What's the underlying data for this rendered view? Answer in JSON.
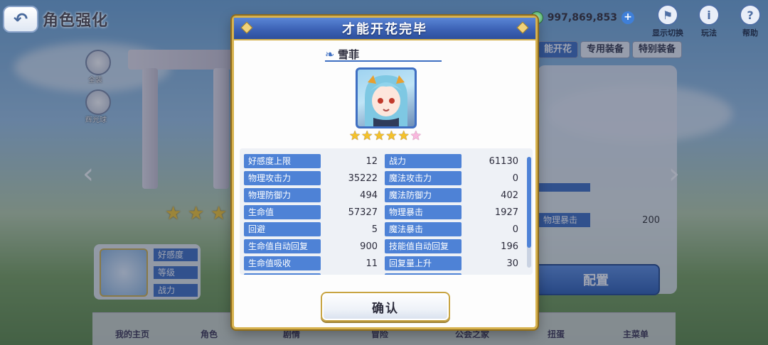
{
  "header": {
    "back_glyph": "↶",
    "title": "角色强化"
  },
  "currency": {
    "gems": "997,869,853",
    "plus": "+"
  },
  "hud_buttons": [
    {
      "icon": "display-toggle-icon",
      "label": "显示切换"
    },
    {
      "icon": "info-icon",
      "label": "玩法"
    },
    {
      "icon": "help-icon",
      "label": "帮助"
    }
  ],
  "side": {
    "btn1": "全装",
    "btn2": "辉光球"
  },
  "tabs": [
    "能开花",
    "专用装备",
    "特别装备"
  ],
  "right_panel": {
    "stat_label": "物理暴击",
    "stat_value": "200",
    "deploy": "配置"
  },
  "left_card": {
    "rows": [
      "好感度",
      "等级",
      "战力"
    ]
  },
  "bottom_nav": [
    "我的主页",
    "角色",
    "剧情",
    "冒险",
    "公会之家",
    "扭蛋",
    "主菜单"
  ],
  "dialog": {
    "title": "才能开花完毕",
    "character_name": "雪菲",
    "stars_filled": 5,
    "stars_total": 6,
    "stats_left": [
      {
        "label": "好感度上限",
        "value": "12"
      },
      {
        "label": "物理攻击力",
        "value": "35222"
      },
      {
        "label": "物理防御力",
        "value": "494"
      },
      {
        "label": "生命值",
        "value": "57327"
      },
      {
        "label": "回避",
        "value": "5"
      },
      {
        "label": "生命值自动回复",
        "value": "900"
      },
      {
        "label": "生命值吸收",
        "value": "11"
      }
    ],
    "stats_right": [
      {
        "label": "战力",
        "value": "61130"
      },
      {
        "label": "魔法攻击力",
        "value": "0"
      },
      {
        "label": "魔法防御力",
        "value": "402"
      },
      {
        "label": "物理暴击",
        "value": "1927"
      },
      {
        "label": "魔法暴击",
        "value": "0"
      },
      {
        "label": "技能值自动回复",
        "value": "196"
      },
      {
        "label": "回复量上升",
        "value": "30"
      }
    ],
    "confirm": "确认"
  },
  "colors": {
    "accent": "#3f6fc2",
    "gold": "#d7b24e",
    "star": "#f5c22a"
  }
}
